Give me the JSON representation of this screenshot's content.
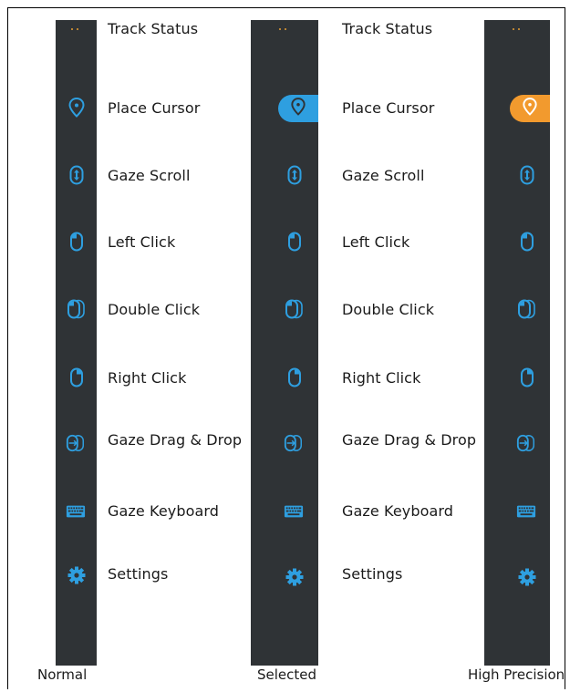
{
  "menu_items": [
    {
      "label": "Track Status",
      "icon": "track-status-dots-icon"
    },
    {
      "label": "Place Cursor",
      "icon": "map-pin-icon"
    },
    {
      "label": "Gaze Scroll",
      "icon": "scroll-arrows-icon"
    },
    {
      "label": "Left Click",
      "icon": "mouse-left-click-icon"
    },
    {
      "label": "Double Click",
      "icon": "mouse-double-click-icon"
    },
    {
      "label": "Right Click",
      "icon": "mouse-right-click-icon"
    },
    {
      "label": "Gaze Drag & Drop",
      "icon": "drag-drop-icon"
    },
    {
      "label": "Gaze Keyboard",
      "icon": "keyboard-icon"
    },
    {
      "label": "Settings",
      "icon": "gear-icon"
    }
  ],
  "captions": {
    "normal": "Normal",
    "selected": "Selected",
    "high_precision": "High Precision"
  },
  "colors": {
    "bar": "#2f3336",
    "icon_blue": "#2e9fe0",
    "selected_pill": "#2e9fe0",
    "precision_pill": "#f29a2e",
    "status_dots": "#e8a033"
  }
}
